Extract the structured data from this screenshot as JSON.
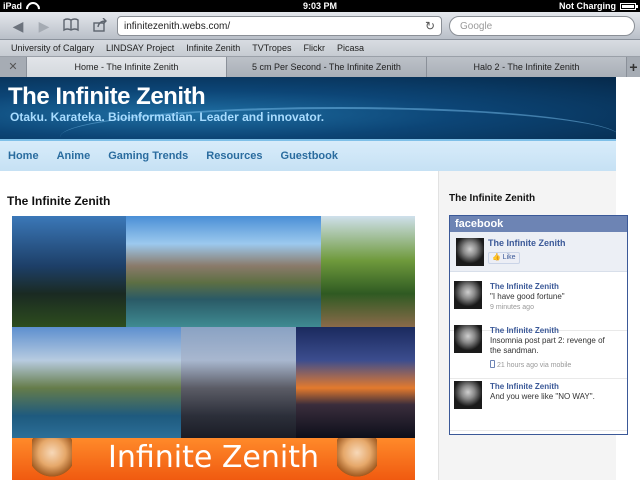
{
  "status_bar": {
    "device": "iPad",
    "time": "9:03 PM",
    "battery_status": "Not Charging"
  },
  "toolbar": {
    "url": "infinitezenith.webs.com/",
    "search_placeholder": "Google"
  },
  "bookmarks": [
    "University of Calgary",
    "LINDSAY Project",
    "Infinite Zenith",
    "TVTropes",
    "Flickr",
    "Picasa"
  ],
  "tabs": [
    {
      "label": "Home - The Infinite Zenith",
      "active": true
    },
    {
      "label": "5 cm Per Second - The Infinite Zenith",
      "active": false
    },
    {
      "label": "Halo 2 - The Infinite Zenith",
      "active": false
    }
  ],
  "site": {
    "title": "The Infinite Zenith",
    "tagline": "Otaku. Karateka. Bioinformatian. Leader and innovator.",
    "nav": [
      "Home",
      "Anime",
      "Gaming Trends",
      "Resources",
      "Guestbook"
    ],
    "main_title": "The Infinite Zenith",
    "banner_text": "Infinite Zenith"
  },
  "sidebar": {
    "title": "The Infinite Zenith",
    "facebook": {
      "header": "facebook",
      "page_name": "The Infinite Zenith",
      "like_label": "Like",
      "posts": [
        {
          "name": "The Infinite Zenith",
          "text": "\"I have good fortune\"",
          "time": "9 minutes ago"
        },
        {
          "name": "The Infinite Zenith",
          "text": "Insomnia post part 2: revenge of the sandman.",
          "time": "21 hours ago via mobile"
        },
        {
          "name": "The Infinite Zenith",
          "text": "And you were like \"NO WAY\".",
          "time": ""
        }
      ]
    }
  },
  "colors": {
    "header_blue": "#0c4576",
    "nav_text": "#2a6c9f",
    "facebook_blue": "#3b5998"
  }
}
